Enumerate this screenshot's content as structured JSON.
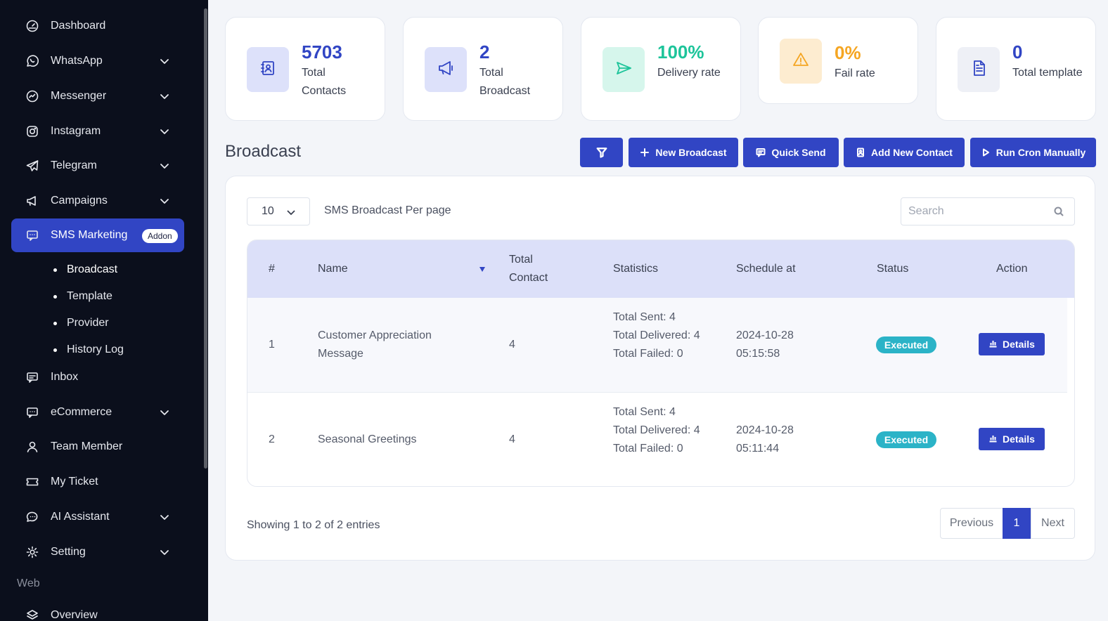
{
  "sidebar": {
    "items": [
      {
        "label": "Dashboard",
        "icon": "gauge-icon",
        "chevron": false
      },
      {
        "label": "WhatsApp",
        "icon": "whatsapp-icon",
        "chevron": true
      },
      {
        "label": "Messenger",
        "icon": "messenger-icon",
        "chevron": true
      },
      {
        "label": "Instagram",
        "icon": "instagram-icon",
        "chevron": true
      },
      {
        "label": "Telegram",
        "icon": "telegram-icon",
        "chevron": true
      },
      {
        "label": "Campaigns",
        "icon": "megaphone-icon",
        "chevron": true
      },
      {
        "label": "SMS Marketing",
        "icon": "sms-icon",
        "chevron": false,
        "badge": "Addon",
        "active": true
      },
      {
        "label": "Inbox",
        "icon": "inbox-icon",
        "chevron": false
      },
      {
        "label": "eCommerce",
        "icon": "ecommerce-icon",
        "chevron": true
      },
      {
        "label": "Team Member",
        "icon": "user-icon",
        "chevron": false
      },
      {
        "label": "My Ticket",
        "icon": "ticket-icon",
        "chevron": false
      },
      {
        "label": "AI Assistant",
        "icon": "ai-chat-icon",
        "chevron": true
      },
      {
        "label": "Setting",
        "icon": "gear-icon",
        "chevron": true
      }
    ],
    "sub_items": [
      "Broadcast",
      "Template",
      "Provider",
      "History Log"
    ],
    "section_heading": "Web",
    "partial_item": "Overview"
  },
  "stats": [
    {
      "value": "5703",
      "caption": "Total Contacts",
      "color": "#3145c4",
      "bg": "#dde1fa",
      "icon": "contact-book-icon"
    },
    {
      "value": "2",
      "caption": "Total Broadcast",
      "color": "#3145c4",
      "bg": "#dde1fa",
      "icon": "megaphone-icon"
    },
    {
      "value": "100%",
      "caption": "Delivery rate",
      "color": "#1dc49a",
      "bg": "#d6f6ec",
      "icon": "send-icon"
    },
    {
      "value": "0%",
      "caption": "Fail rate",
      "color": "#f5a623",
      "bg": "#fdecd0",
      "icon": "warning-icon"
    },
    {
      "value": "0",
      "caption": "Total template",
      "color": "#3145c4",
      "bg": "#eef0f6",
      "icon": "document-icon"
    }
  ],
  "page_title": "Broadcast",
  "toolbar": {
    "new_broadcast": "New Broadcast",
    "quick_send": "Quick Send",
    "add_contact": "Add New Contact",
    "run_cron": "Run Cron Manually"
  },
  "table_controls": {
    "per_page_value": "10",
    "per_page_label": "SMS Broadcast Per page",
    "search_placeholder": "Search"
  },
  "table": {
    "headers": [
      "#",
      "Name",
      "Total Contact",
      "Statistics",
      "Schedule at",
      "Status",
      "Action"
    ],
    "rows": [
      {
        "num": "1",
        "name": "Customer Appreciation Message",
        "total_contact": "4",
        "sent": "Total Sent: 4",
        "delivered": "Total Delivered: 4",
        "failed": "Total Failed: 0",
        "schedule": "2024-10-28 05:15:58",
        "status": "Executed",
        "action": "Details"
      },
      {
        "num": "2",
        "name": "Seasonal Greetings",
        "total_contact": "4",
        "sent": "Total Sent: 4",
        "delivered": "Total Delivered: 4",
        "failed": "Total Failed: 0",
        "schedule": "2024-10-28 05:11:44",
        "status": "Executed",
        "action": "Details"
      }
    ]
  },
  "footer": {
    "showing": "Showing 1 to 2 of 2 entries",
    "previous": "Previous",
    "current_page": "1",
    "next": "Next"
  }
}
